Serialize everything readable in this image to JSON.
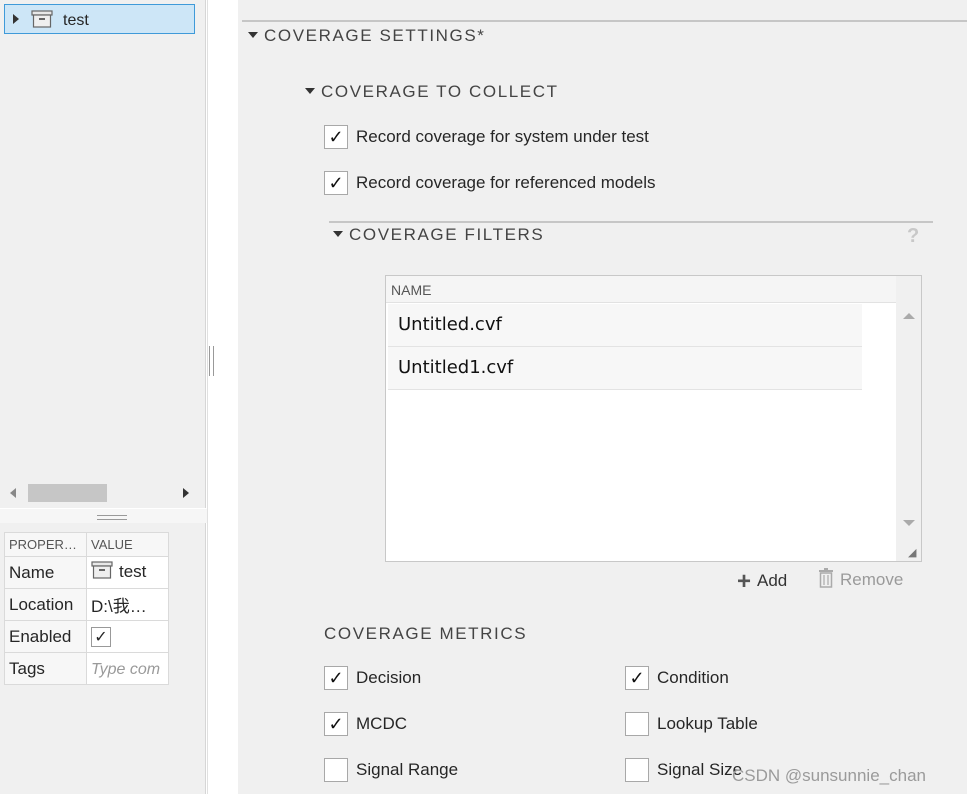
{
  "tree": {
    "items": [
      {
        "label": "test",
        "icon": "test-suite-icon",
        "selected": true
      }
    ]
  },
  "properties": {
    "headers": [
      "PROPER…",
      "VALUE"
    ],
    "rows": [
      {
        "key": "Name",
        "value": "test",
        "icon": "test-suite-icon"
      },
      {
        "key": "Location",
        "value": "D:\\我…"
      },
      {
        "key": "Enabled",
        "checked": true
      },
      {
        "key": "Tags",
        "placeholder": "Type com"
      }
    ]
  },
  "coverage_settings": {
    "title": "COVERAGE SETTINGS*",
    "collect": {
      "title": "COVERAGE TO COLLECT",
      "options": [
        {
          "label": "Record coverage for system under test",
          "checked": true
        },
        {
          "label": "Record coverage for referenced models",
          "checked": true
        }
      ]
    },
    "filters": {
      "title": "COVERAGE FILTERS",
      "help": "?",
      "column": "NAME",
      "files": [
        "Untitled.cvf",
        "Untitled1.cvf"
      ],
      "add_label": "Add",
      "remove_label": "Remove"
    },
    "metrics": {
      "title": "COVERAGE METRICS",
      "items": [
        {
          "label": "Decision",
          "checked": true
        },
        {
          "label": "Condition",
          "checked": true
        },
        {
          "label": "MCDC",
          "checked": true
        },
        {
          "label": "Lookup Table",
          "checked": false
        },
        {
          "label": "Signal Range",
          "checked": false
        },
        {
          "label": "Signal Size",
          "checked": false
        }
      ]
    }
  },
  "watermark": "CSDN @sunsunnie_chan",
  "colors": {
    "selection_bg": "#cde6f7",
    "selection_border": "#3f9ad9",
    "panel_bg": "#f0f0f0"
  }
}
